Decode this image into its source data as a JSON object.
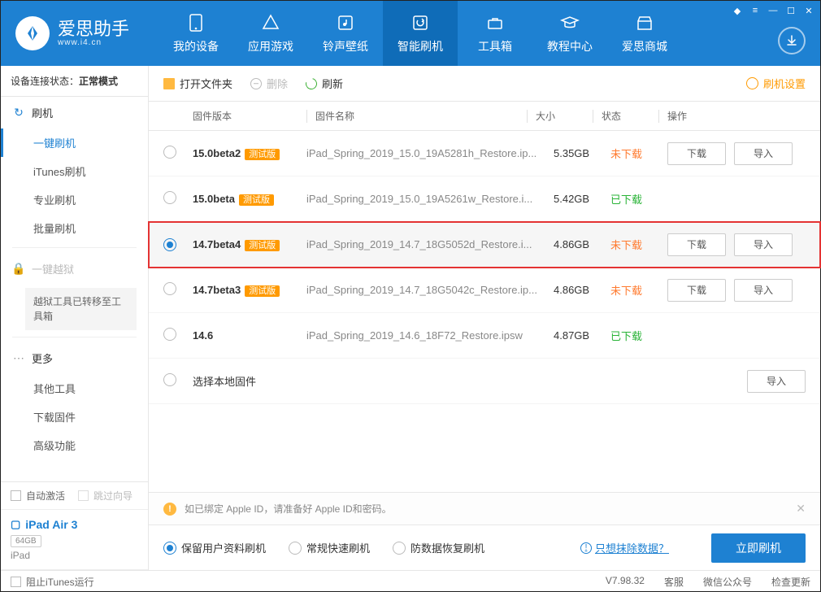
{
  "app": {
    "name": "爱思助手",
    "site": "www.i4.cn"
  },
  "nav": [
    {
      "label": "我的设备"
    },
    {
      "label": "应用游戏"
    },
    {
      "label": "铃声壁纸"
    },
    {
      "label": "智能刷机"
    },
    {
      "label": "工具箱"
    },
    {
      "label": "教程中心"
    },
    {
      "label": "爱思商城"
    }
  ],
  "status": {
    "prefix": "设备连接状态：",
    "value": "正常模式"
  },
  "sidebar": {
    "flash": {
      "label": "刷机",
      "items": [
        "一键刷机",
        "iTunes刷机",
        "专业刷机",
        "批量刷机"
      ]
    },
    "jailbreak": {
      "label": "一键越狱",
      "note": "越狱工具已转移至工具箱"
    },
    "more": {
      "label": "更多",
      "items": [
        "其他工具",
        "下载固件",
        "高级功能"
      ]
    }
  },
  "bottom": {
    "autoActivate": "自动激活",
    "skipGuide": "跳过向导",
    "deviceName": "iPad Air 3",
    "deviceStorage": "64GB",
    "deviceType": "iPad",
    "blockItunes": "阻止iTunes运行"
  },
  "toolbar": {
    "open": "打开文件夹",
    "delete": "删除",
    "refresh": "刷新",
    "settings": "刷机设置"
  },
  "columns": {
    "version": "固件版本",
    "name": "固件名称",
    "size": "大小",
    "status": "状态",
    "action": "操作"
  },
  "rows": [
    {
      "version": "15.0beta2",
      "beta": "测试版",
      "name": "iPad_Spring_2019_15.0_19A5281h_Restore.ip...",
      "size": "5.35GB",
      "status": "未下载",
      "downloaded": false,
      "selected": false,
      "dl": "下载",
      "imp": "导入"
    },
    {
      "version": "15.0beta",
      "beta": "测试版",
      "name": "iPad_Spring_2019_15.0_19A5261w_Restore.i...",
      "size": "5.42GB",
      "status": "已下载",
      "downloaded": true,
      "selected": false
    },
    {
      "version": "14.7beta4",
      "beta": "测试版",
      "name": "iPad_Spring_2019_14.7_18G5052d_Restore.i...",
      "size": "4.86GB",
      "status": "未下载",
      "downloaded": false,
      "selected": true,
      "dl": "下载",
      "imp": "导入"
    },
    {
      "version": "14.7beta3",
      "beta": "测试版",
      "name": "iPad_Spring_2019_14.7_18G5042c_Restore.ip...",
      "size": "4.86GB",
      "status": "未下载",
      "downloaded": false,
      "selected": false,
      "dl": "下载",
      "imp": "导入"
    },
    {
      "version": "14.6",
      "beta": "",
      "name": "iPad_Spring_2019_14.6_18F72_Restore.ipsw",
      "size": "4.87GB",
      "status": "已下载",
      "downloaded": true,
      "selected": false
    }
  ],
  "localRow": {
    "label": "选择本地固件",
    "imp": "导入"
  },
  "alert": {
    "text": "如已绑定 Apple ID，请准备好 Apple ID和密码。"
  },
  "modes": {
    "keep": "保留用户资料刷机",
    "normal": "常规快速刷机",
    "recover": "防数据恢复刷机",
    "link": "只想抹除数据？",
    "go": "立即刷机"
  },
  "footer": {
    "version": "V7.98.32",
    "service": "客服",
    "wechat": "微信公众号",
    "update": "检查更新"
  }
}
